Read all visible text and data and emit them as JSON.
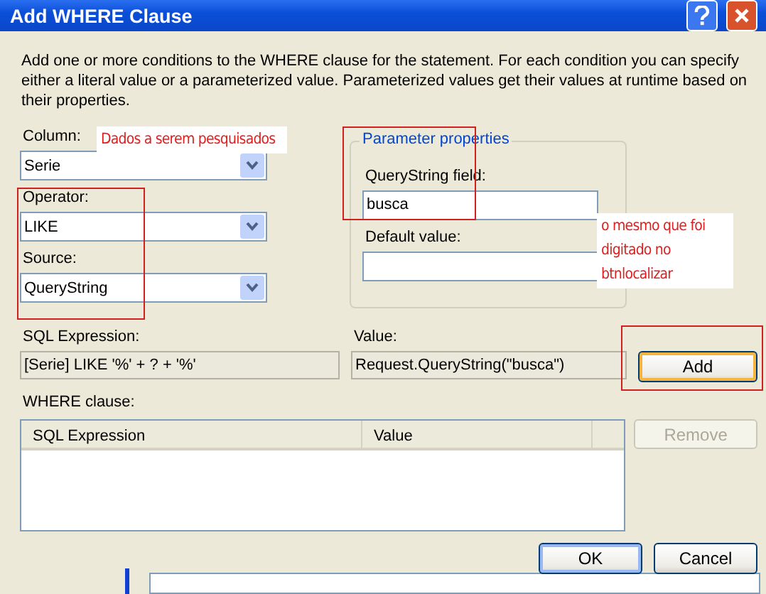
{
  "window": {
    "title": "Add WHERE Clause"
  },
  "description": "Add one or more conditions to the WHERE clause for the statement. For each condition you can specify either a literal value or a parameterized value. Parameterized values get their values at runtime based on their properties.",
  "selectors": [
    {
      "label": "Column:",
      "value": "Serie"
    },
    {
      "label": "Operator:",
      "value": "LIKE"
    },
    {
      "label": "Source:",
      "value": "QueryString"
    }
  ],
  "parameter_properties": {
    "title": "Parameter properties",
    "fields": [
      {
        "label": "QueryString field:",
        "value": "busca"
      },
      {
        "label": "Default value:"
      }
    ]
  },
  "sql_expression": {
    "label": "SQL Expression:",
    "value": "[Serie] LIKE '%' + ? + '%'"
  },
  "value": {
    "label": "Value:",
    "value": "Request.QueryString(\"busca\")"
  },
  "add_button": "Add",
  "where_clause": {
    "label": "WHERE clause:",
    "columns": [
      "SQL Expression",
      "Value"
    ]
  },
  "remove_button": {
    "label": "Remove",
    "disabled": true
  },
  "buttons": [
    "OK",
    "Cancel"
  ],
  "annotations": [
    {
      "lines": [
        "Dados a serem pesquisados"
      ]
    },
    {
      "lines": [
        "o mesmo que foi",
        "digitado no",
        "btnlocalizar"
      ]
    }
  ]
}
